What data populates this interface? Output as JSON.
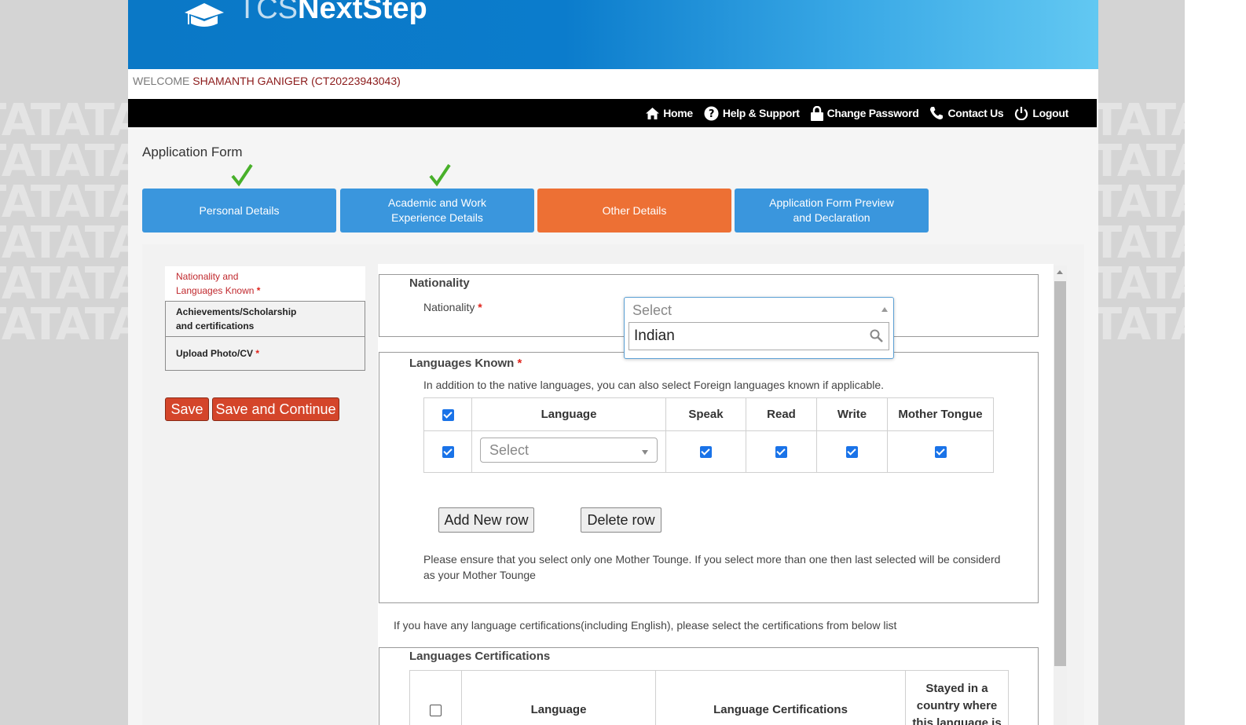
{
  "brand": {
    "logo_light": "TCS",
    "logo_bold": "NextStep"
  },
  "welcome": {
    "prefix": "WELCOME",
    "user": "SHAMANTH GANIGER (CT20223943043)"
  },
  "watermark": "TATATA",
  "nav": [
    {
      "icon": "home-icon",
      "label": "Home"
    },
    {
      "icon": "help-icon",
      "label": "Help & Support"
    },
    {
      "icon": "lock-icon",
      "label": "Change Password"
    },
    {
      "icon": "phone-icon",
      "label": "Contact Us"
    },
    {
      "icon": "power-icon",
      "label": "Logout"
    }
  ],
  "page_title": "Application Form",
  "steps": [
    {
      "line1": "Personal Details",
      "line2": "",
      "completed": true,
      "active": false
    },
    {
      "line1": "Academic and Work",
      "line2": "Experience Details",
      "completed": true,
      "active": false
    },
    {
      "line1": "Other Details",
      "line2": "",
      "completed": false,
      "active": true
    },
    {
      "line1": "Application Form Preview",
      "line2": "and Declaration",
      "completed": false,
      "active": false
    }
  ],
  "side_menu": [
    {
      "line1": "Nationality and",
      "line2": "Languages Known",
      "required": "*"
    },
    {
      "line1": "Achievements/Scholarship",
      "line2": "and certifications",
      "required": ""
    },
    {
      "line1": "Upload Photo/CV",
      "line2": "",
      "required": "*"
    }
  ],
  "buttons": {
    "save": "Save",
    "save_continue": "Save and Continue",
    "add_row": "Add New row",
    "delete_row": "Delete row"
  },
  "nationality": {
    "legend": "Nationality",
    "label": "Nationality",
    "required": "*",
    "select_value": "Select",
    "search_value": "Indian"
  },
  "languages_known": {
    "legend": "Languages Known",
    "required": "*",
    "intro": "In addition to the native languages, you can also select Foreign languages known if applicable.",
    "columns": [
      "Language",
      "Speak",
      "Read",
      "Write",
      "Mother Tongue"
    ],
    "header_checked": true,
    "rows": [
      {
        "checked": true,
        "language": "Select",
        "speak": true,
        "read": true,
        "write": true,
        "mother_tongue": true
      }
    ],
    "note_line1": "Please ensure that you select only one Mother Tounge. If you select more than one then last selected will be considerd",
    "note_line2": "as your Mother Tounge"
  },
  "cert_intro": "If you have any language certifications(including English), please select the certifications from below list",
  "languages_certifications": {
    "legend": "Languages Certifications",
    "columns": [
      "Language",
      "Language Certifications"
    ],
    "stayed_line1": "Stayed in a",
    "stayed_line2": "country where",
    "stayed_line3": "this language is",
    "header_checked": false
  },
  "colors": {
    "header_blue": "#0a78c6",
    "step_blue": "#3a96dd",
    "step_active": "#ed7034",
    "save_red": "#d4452a",
    "required_red": "#e0231b"
  }
}
